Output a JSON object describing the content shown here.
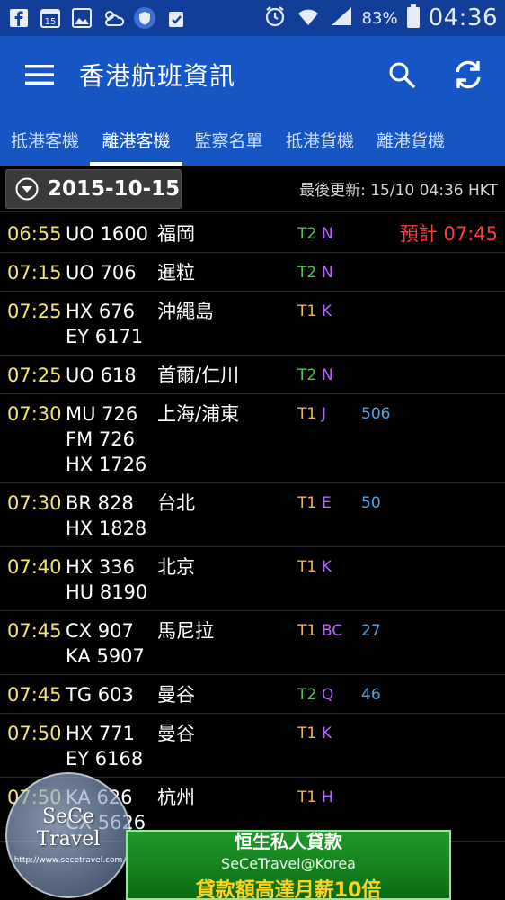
{
  "status_bar": {
    "battery": "83%",
    "time": "04:36",
    "icons": [
      "facebook-icon",
      "calendar-15-icon",
      "gallery-icon",
      "weather-icon",
      "shield-icon",
      "clipboard-icon"
    ],
    "calendar_day": "15"
  },
  "app_bar": {
    "title": "香港航班資訊"
  },
  "tabs": [
    "抵港客機",
    "離港客機",
    "監察名單",
    "抵港貨機",
    "離港貨機"
  ],
  "active_tab": 1,
  "date_row": {
    "date": "2015-10-15",
    "last_updated": "最後更新: 15/10 04:36 HKT"
  },
  "flights": [
    {
      "time": "06:55",
      "flights": [
        "UO 1600"
      ],
      "dest": "福岡",
      "terminal": "T2",
      "gate": "N",
      "extra": "",
      "remark": "預計 07:45"
    },
    {
      "time": "07:15",
      "flights": [
        "UO 706"
      ],
      "dest": "暹粒",
      "terminal": "T2",
      "gate": "N",
      "extra": "",
      "remark": ""
    },
    {
      "time": "07:25",
      "flights": [
        "HX 676",
        "EY 6171"
      ],
      "dest": "沖繩島",
      "terminal": "T1",
      "gate": "K",
      "extra": "",
      "remark": ""
    },
    {
      "time": "07:25",
      "flights": [
        "UO 618"
      ],
      "dest": "首爾/仁川",
      "terminal": "T2",
      "gate": "N",
      "extra": "",
      "remark": ""
    },
    {
      "time": "07:30",
      "flights": [
        "MU 726",
        "FM 726",
        "HX 1726"
      ],
      "dest": "上海/浦東",
      "terminal": "T1",
      "gate": "J",
      "extra": "506",
      "remark": ""
    },
    {
      "time": "07:30",
      "flights": [
        "BR 828",
        "HX 1828"
      ],
      "dest": "台北",
      "terminal": "T1",
      "gate": "E",
      "extra": "50",
      "remark": ""
    },
    {
      "time": "07:40",
      "flights": [
        "HX 336",
        "HU 8190"
      ],
      "dest": "北京",
      "terminal": "T1",
      "gate": "K",
      "extra": "",
      "remark": ""
    },
    {
      "time": "07:45",
      "flights": [
        "CX 907",
        "KA 5907"
      ],
      "dest": "馬尼拉",
      "terminal": "T1",
      "gate": "BC",
      "extra": "27",
      "remark": ""
    },
    {
      "time": "07:45",
      "flights": [
        "TG 603"
      ],
      "dest": "曼谷",
      "terminal": "T2",
      "gate": "Q",
      "extra": "46",
      "remark": ""
    },
    {
      "time": "07:50",
      "flights": [
        "HX 771",
        "EY 6168"
      ],
      "dest": "曼谷",
      "terminal": "T1",
      "gate": "K",
      "extra": "",
      "remark": ""
    },
    {
      "time": "07:50",
      "flights": [
        "KA 626",
        "CX 5626"
      ],
      "dest": "杭州",
      "terminal": "T1",
      "gate": "H",
      "extra": "",
      "remark": ""
    }
  ],
  "watermark": {
    "title": "SeCe",
    "subtitle": "Travel",
    "url": "http://www.secetravel.com"
  },
  "ad": {
    "title": "恒生私人貸款",
    "line": "SeCeTravel@Korea",
    "cta": "貸款額高達月薪10倍"
  },
  "colors": {
    "status_bar": "#123e9a",
    "app_bar": "#1656c4",
    "time": "#f4e66a",
    "remark": "#ff3b3b",
    "t1": "#f0b25a",
    "t2": "#4ec44e",
    "gate": "#b266ff",
    "extra": "#4ea3e6"
  }
}
